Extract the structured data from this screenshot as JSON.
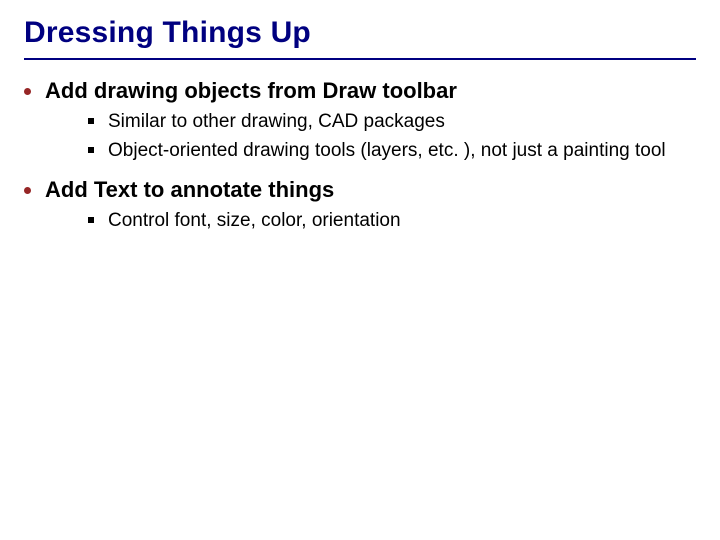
{
  "title": "Dressing Things Up",
  "sections": [
    {
      "heading": "Add drawing objects from Draw toolbar",
      "items": [
        "Similar to other drawing, CAD packages",
        "Object-oriented drawing tools (layers, etc. ), not just a painting tool"
      ]
    },
    {
      "heading": "Add Text to annotate things",
      "items": [
        "Control font, size, color, orientation"
      ]
    }
  ]
}
